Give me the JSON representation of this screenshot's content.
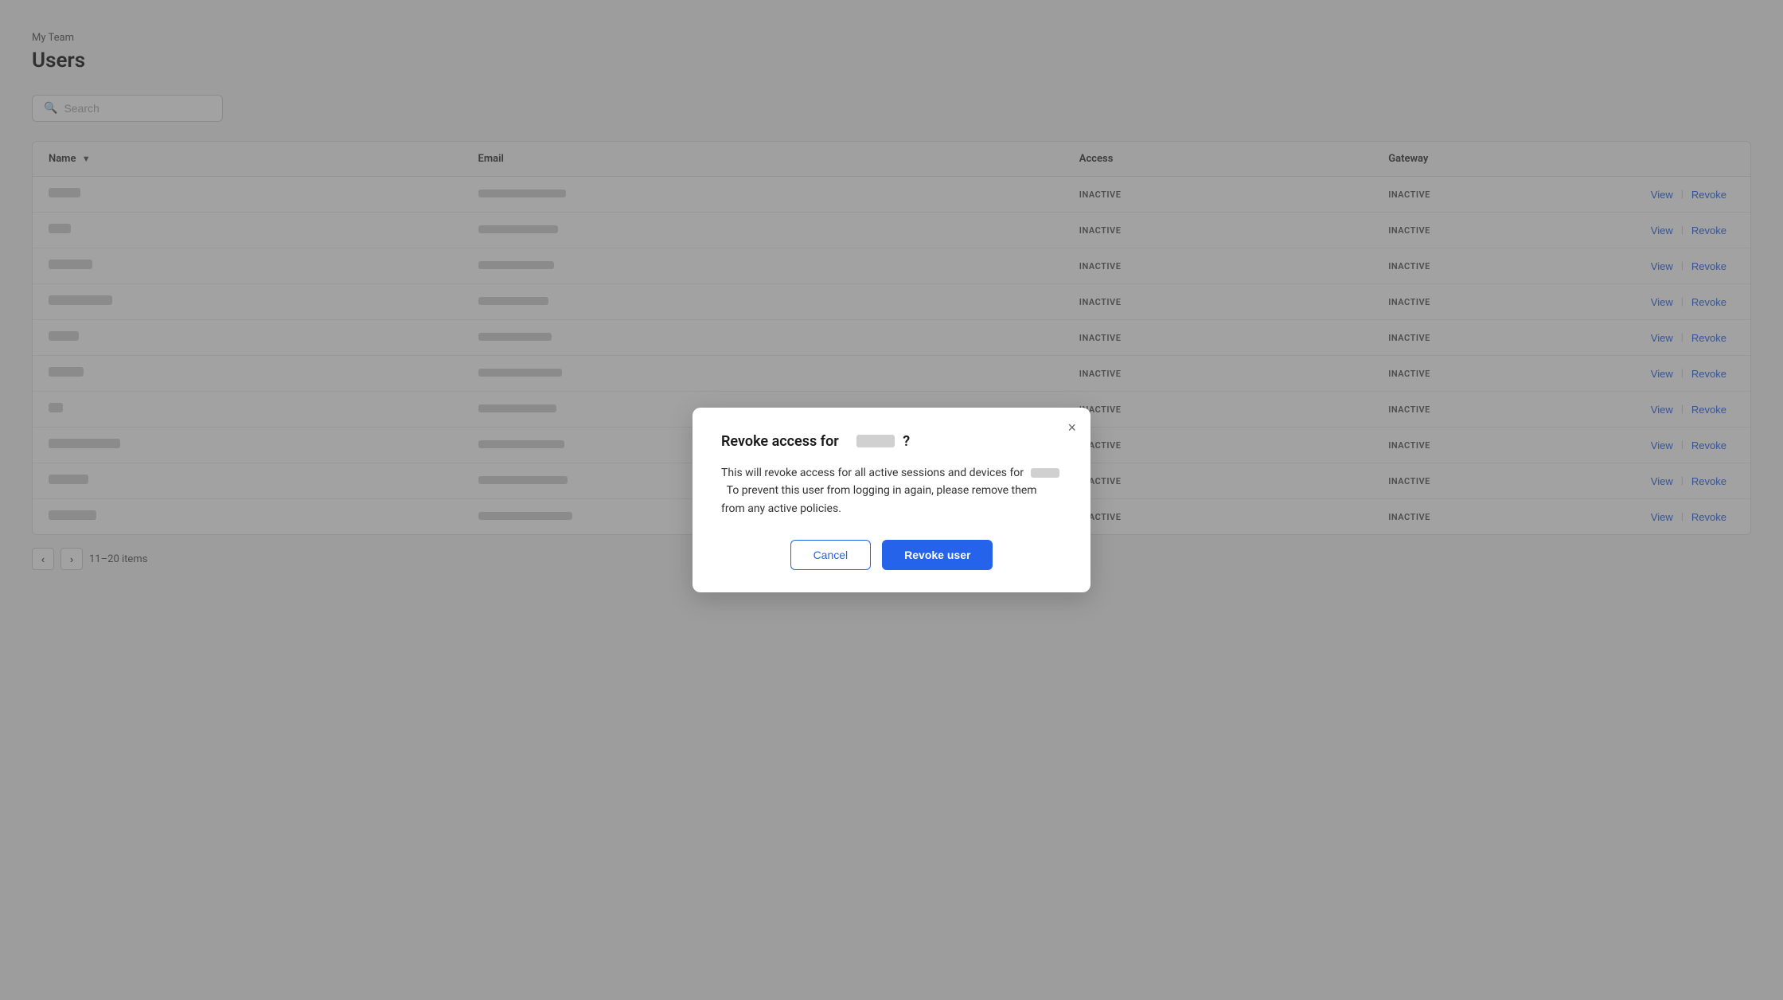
{
  "breadcrumb": "My Team",
  "page_title": "Users",
  "search": {
    "placeholder": "Search"
  },
  "table": {
    "columns": [
      {
        "key": "name",
        "label": "Name",
        "sortable": true
      },
      {
        "key": "email",
        "label": "Email",
        "sortable": false
      },
      {
        "key": "access",
        "label": "Access",
        "sortable": false
      },
      {
        "key": "gateway",
        "label": "Gateway",
        "sortable": false
      }
    ],
    "rows": [
      {
        "name_w": 40,
        "email_w": 110,
        "access": "INACTIVE",
        "gateway": "INACTIVE"
      },
      {
        "name_w": 28,
        "email_w": 100,
        "access": "INACTIVE",
        "gateway": "INACTIVE"
      },
      {
        "name_w": 55,
        "email_w": 95,
        "access": "INACTIVE",
        "gateway": "INACTIVE"
      },
      {
        "name_w": 80,
        "email_w": 88,
        "access": "INACTIVE",
        "gateway": "INACTIVE"
      },
      {
        "name_w": 38,
        "email_w": 92,
        "access": "INACTIVE",
        "gateway": "INACTIVE"
      },
      {
        "name_w": 44,
        "email_w": 105,
        "access": "INACTIVE",
        "gateway": "INACTIVE"
      },
      {
        "name_w": 18,
        "email_w": 98,
        "access": "INACTIVE",
        "gateway": "INACTIVE"
      },
      {
        "name_w": 90,
        "email_w": 108,
        "access": "INACTIVE",
        "gateway": "INACTIVE"
      },
      {
        "name_w": 50,
        "email_w": 112,
        "access": "INACTIVE",
        "gateway": "INACTIVE"
      },
      {
        "name_w": 60,
        "email_w": 118,
        "access": "INACTIVE",
        "gateway": "INACTIVE"
      }
    ],
    "action_view": "View",
    "action_revoke": "Revoke",
    "action_separator": "|"
  },
  "pagination": {
    "prev_label": "‹",
    "next_label": "›",
    "range_label": "11–20 items"
  },
  "modal": {
    "title_prefix": "Revoke access for",
    "title_suffix": "?",
    "close_label": "×",
    "body_prefix": "This will revoke access for all active sessions and devices for",
    "body_suffix": "To prevent this user from logging in again, please remove them from any active policies.",
    "cancel_label": "Cancel",
    "revoke_label": "Revoke user"
  }
}
